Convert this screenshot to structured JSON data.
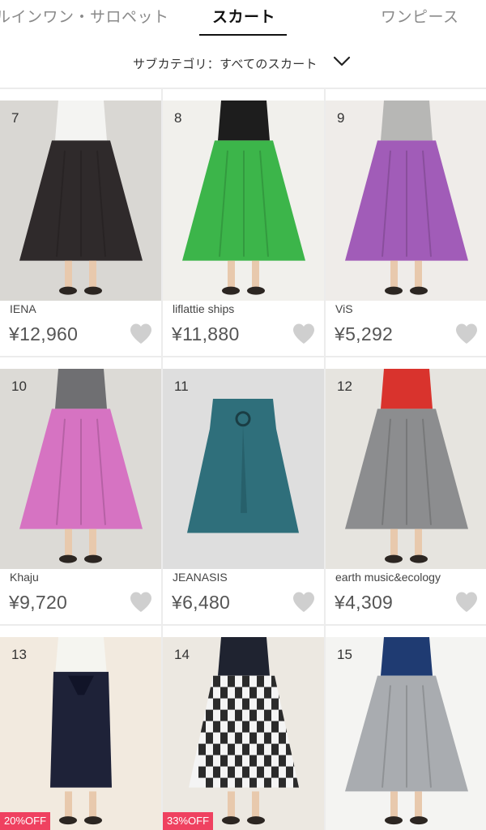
{
  "tabs": {
    "left": "ルインワン・サロペット",
    "active": "スカート",
    "right": "ワンピース"
  },
  "subcategory": {
    "label": "サブカテゴリ：すべてのスカート",
    "icon": "chevron-down-icon"
  },
  "colors": {
    "accent": "#ef4160",
    "heart": "#cfcfcf",
    "grid_bg": "#ececec"
  },
  "products": [
    {
      "rank": "7",
      "brand": "IENA",
      "price": "¥12,960",
      "skirt_color": "#2f2a2b",
      "bg": "#d9d7d3",
      "top": "#f4f4f2"
    },
    {
      "rank": "8",
      "brand": "liflattie ships",
      "price": "¥11,880",
      "skirt_color": "#3cb54a",
      "bg": "#f1f0ec",
      "top": "#1d1d1d"
    },
    {
      "rank": "9",
      "brand": "ViS",
      "price": "¥5,292",
      "skirt_color": "#a15cb8",
      "bg": "#efece9",
      "top": "#b7b7b5"
    },
    {
      "rank": "10",
      "brand": "Khaju",
      "price": "¥9,720",
      "skirt_color": "#d673c2",
      "bg": "#dcdad6",
      "top": "#6f6f72"
    },
    {
      "rank": "11",
      "brand": "JEANASIS",
      "price": "¥6,480",
      "skirt_color": "#2f6f7b",
      "bg": "#dedede",
      "top": ""
    },
    {
      "rank": "12",
      "brand": "earth music&ecology",
      "price": "¥4,309",
      "skirt_color": "#8c8d8f",
      "bg": "#e6e4df",
      "top": "#d9332d"
    },
    {
      "rank": "13",
      "brand": "",
      "price": "",
      "skirt_color": "#1e2238",
      "bg": "#f2eadf",
      "top": "#f5f5f0",
      "badge": "20%OFF"
    },
    {
      "rank": "14",
      "brand": "",
      "price": "",
      "skirt_color": "#2b2b2b",
      "bg": "#ece8e1",
      "top": "#1f2330",
      "badge": "33%OFF"
    },
    {
      "rank": "15",
      "brand": "",
      "price": "",
      "skirt_color": "#a9acb0",
      "bg": "#f4f4f2",
      "top": "#1f3b72"
    }
  ]
}
